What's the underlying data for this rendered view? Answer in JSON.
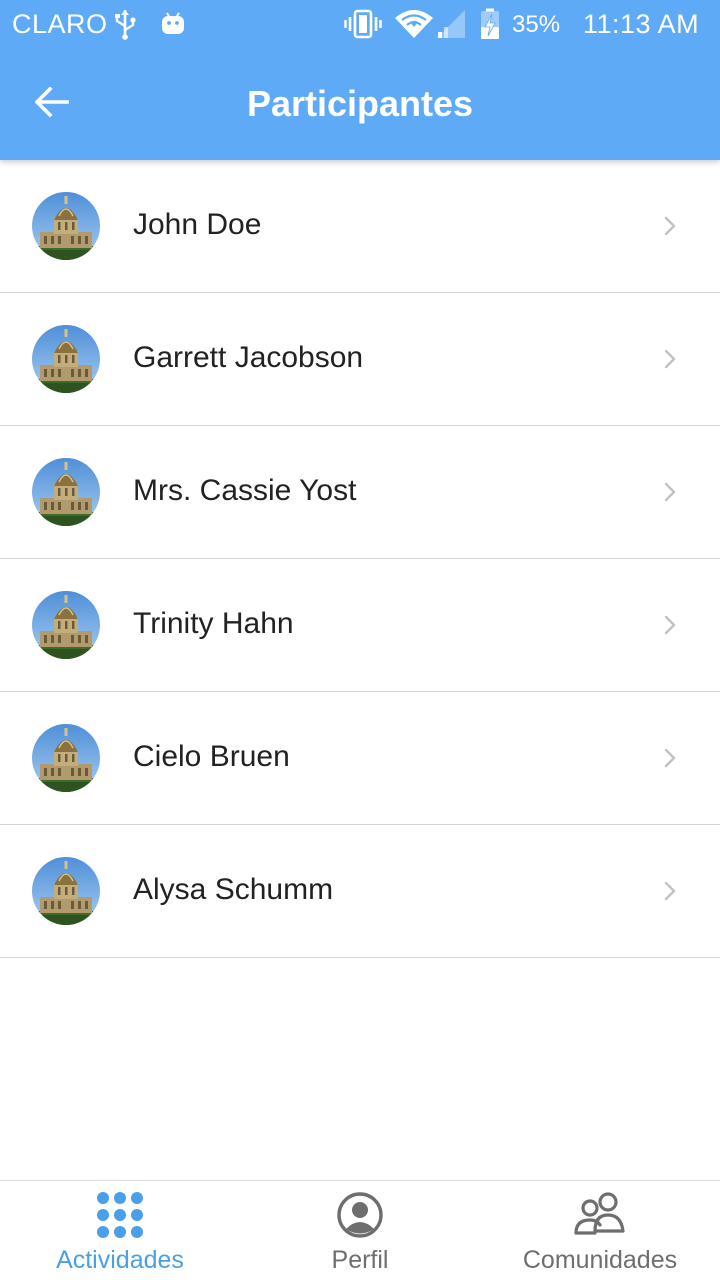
{
  "status_bar": {
    "carrier": "CLARO",
    "battery_percent": "35%",
    "time": "11:13 AM"
  },
  "app_bar": {
    "title": "Participantes",
    "back_icon": "arrow-left-icon"
  },
  "participants": [
    {
      "name": "John Doe"
    },
    {
      "name": "Garrett Jacobson"
    },
    {
      "name": "Mrs. Cassie Yost"
    },
    {
      "name": "Trinity Hahn"
    },
    {
      "name": "Cielo Bruen"
    },
    {
      "name": "Alysa Schumm"
    }
  ],
  "tabs": [
    {
      "label": "Actividades",
      "icon": "grid-dots-icon",
      "active": true
    },
    {
      "label": "Perfil",
      "icon": "user-circle-icon",
      "active": false
    },
    {
      "label": "Comunidades",
      "icon": "users-group-icon",
      "active": false
    }
  ],
  "colors": {
    "primary": "#5faaf7",
    "active_tab": "#4a9fe9",
    "inactive_tab": "#6e6e6e",
    "divider": "#d6d6d6"
  }
}
